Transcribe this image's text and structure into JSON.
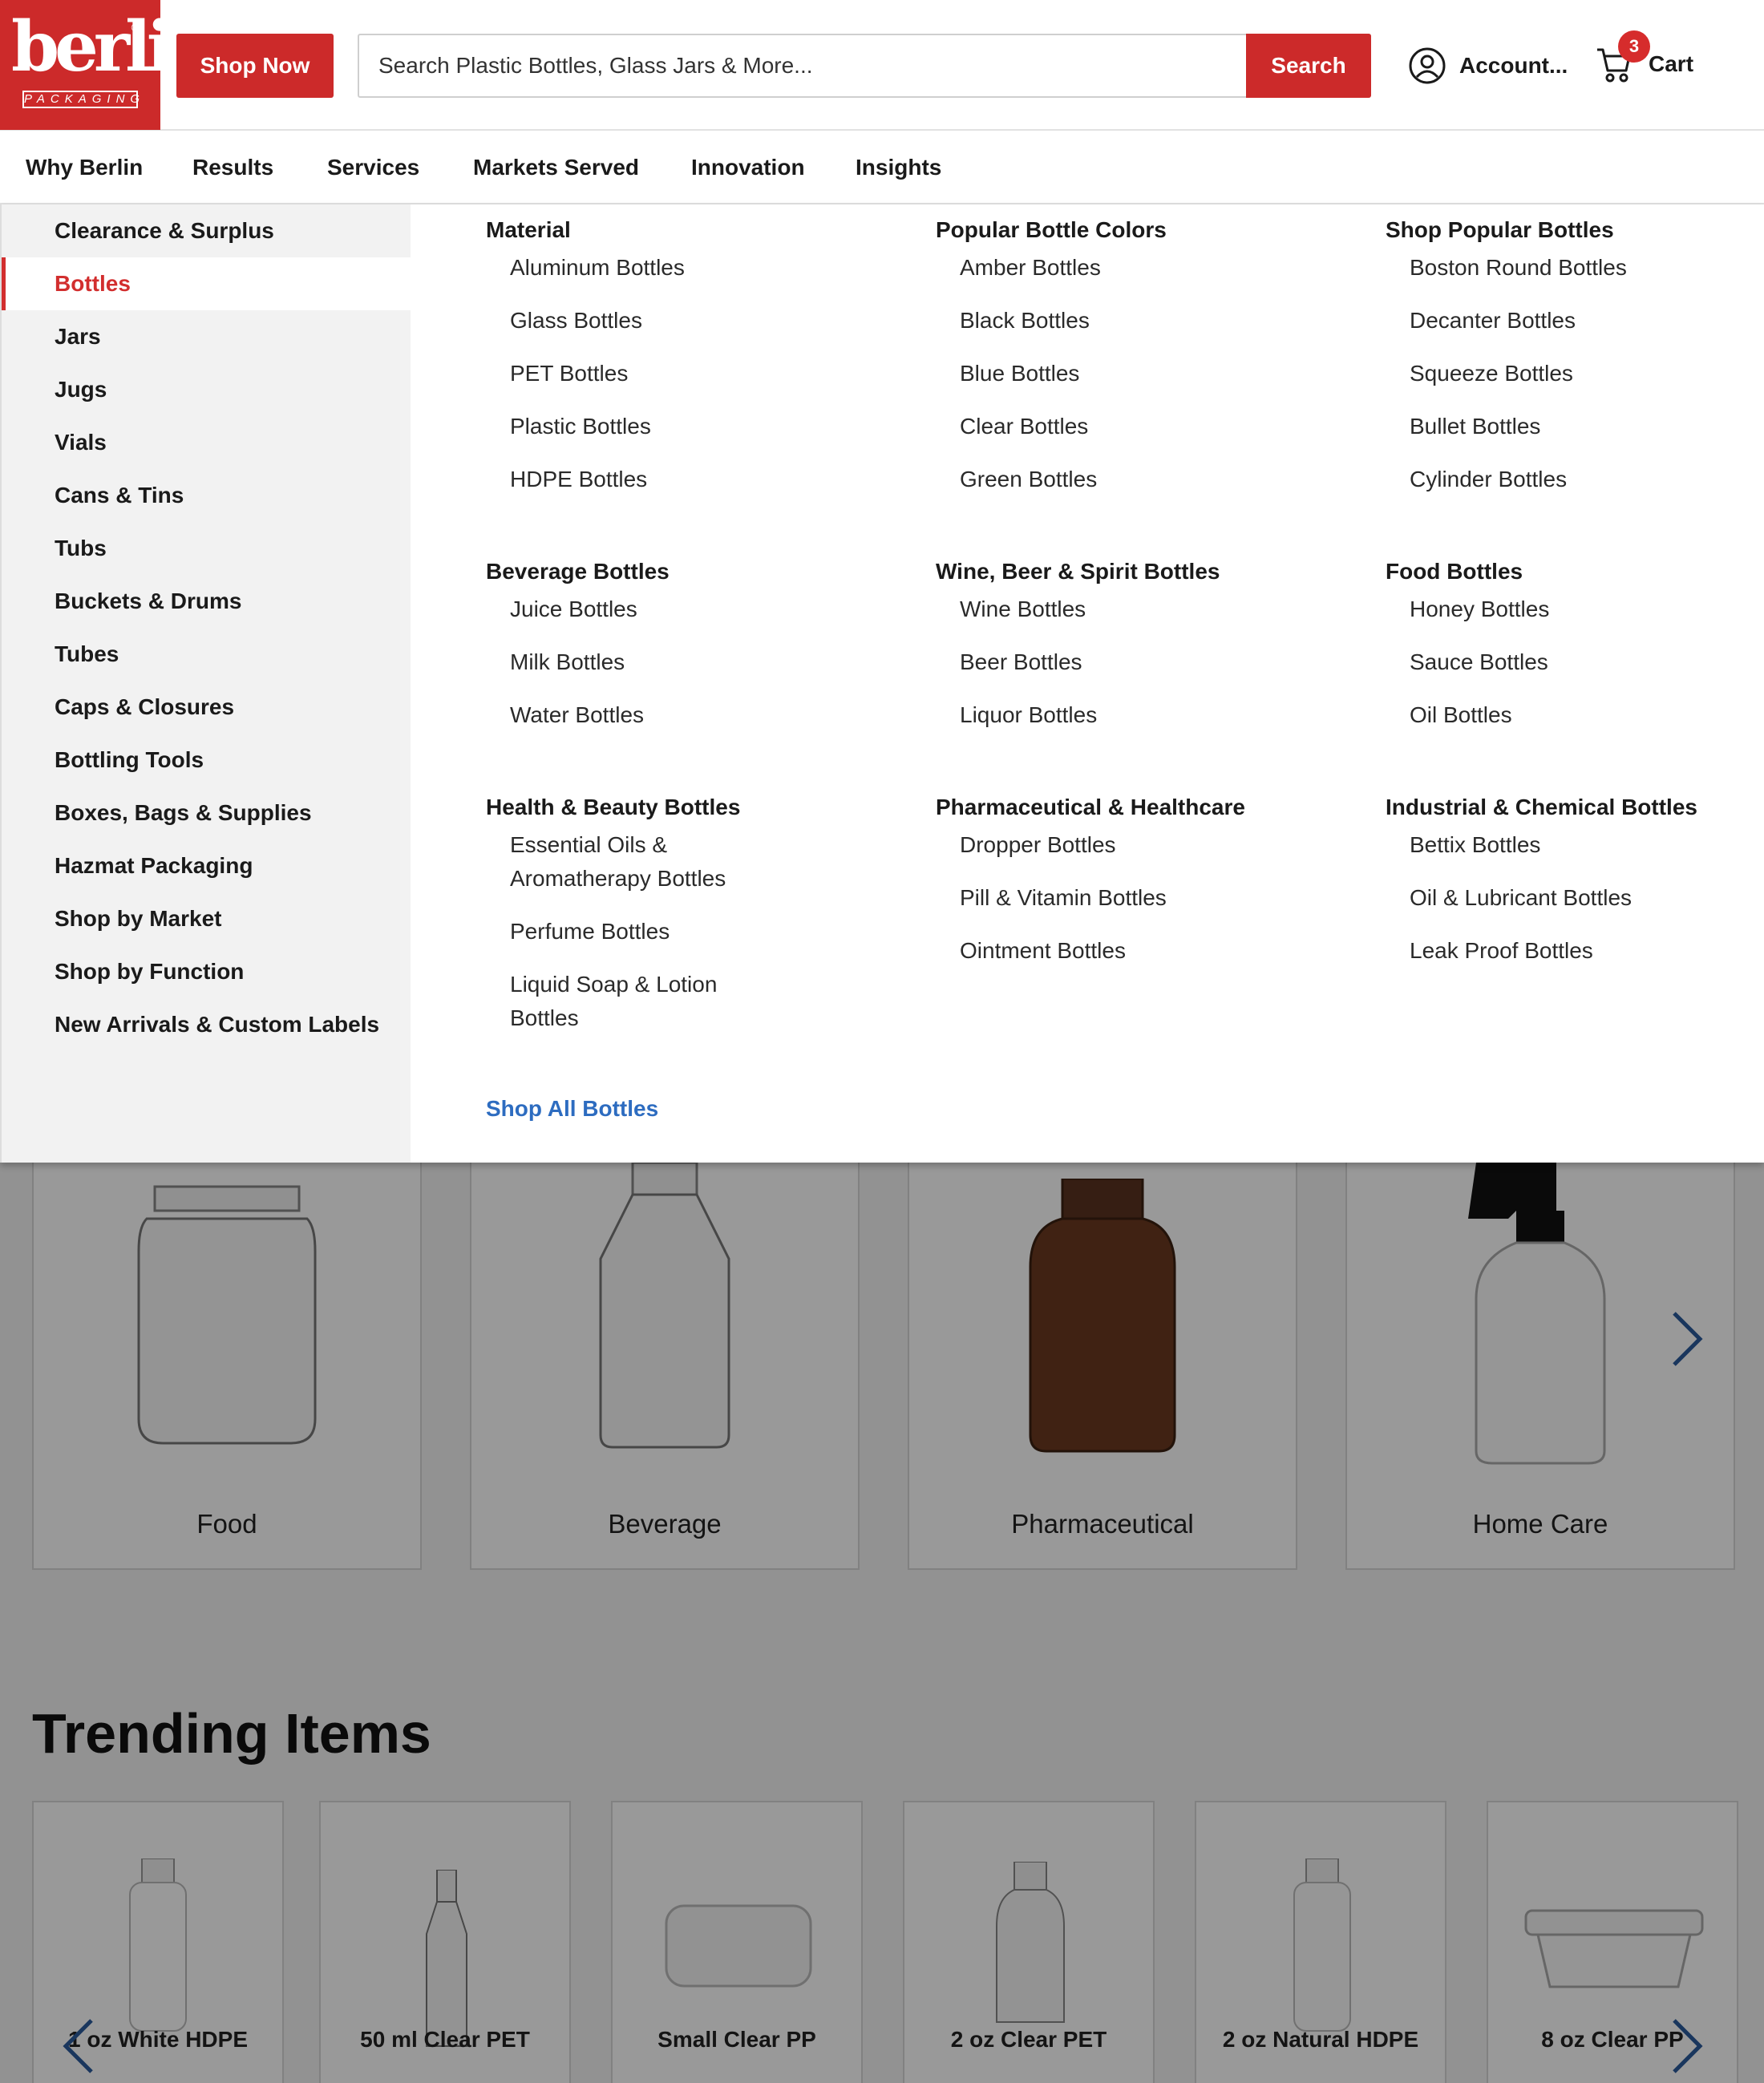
{
  "header": {
    "logo_text": "berlin",
    "logo_sub": "PACKAGING",
    "shop_now": "Shop Now",
    "search_placeholder": "Search Plastic Bottles, Glass Jars & More...",
    "search_button": "Search",
    "account": "Account...",
    "cart_label": "Cart",
    "cart_count": "3"
  },
  "nav": [
    "Why Berlin",
    "Results",
    "Services",
    "Markets Served",
    "Innovation",
    "Insights"
  ],
  "sidebar": [
    "Clearance & Surplus",
    "Bottles",
    "Jars",
    "Jugs",
    "Vials",
    "Cans & Tins",
    "Tubs",
    "Buckets & Drums",
    "Tubes",
    "Caps & Closures",
    "Bottling Tools",
    "Boxes, Bags & Supplies",
    "Hazmat Packaging",
    "Shop by Market",
    "Shop by Function",
    "New Arrivals & Custom Labels"
  ],
  "sidebar_active": "Bottles",
  "menu": {
    "col1": {
      "material": {
        "title": "Material",
        "links": [
          "Aluminum Bottles",
          "Glass Bottles",
          "PET Bottles",
          "Plastic Bottles",
          "HDPE Bottles"
        ]
      },
      "beverage": {
        "title": "Beverage Bottles",
        "links": [
          "Juice Bottles",
          "Milk Bottles",
          "Water Bottles"
        ]
      },
      "health": {
        "title": "Health & Beauty Bottles",
        "links": [
          "Essential Oils &",
          "Aromatherapy Bottles",
          "Perfume Bottles",
          "Liquid Soap & Lotion",
          "Bottles"
        ]
      }
    },
    "col2": {
      "colors": {
        "title": "Popular Bottle Colors",
        "links": [
          "Amber Bottles",
          "Black Bottles",
          "Blue Bottles",
          "Clear Bottles",
          "Green Bottles"
        ]
      },
      "wine": {
        "title": "Wine, Beer & Spirit Bottles",
        "links": [
          "Wine Bottles",
          "Beer Bottles",
          "Liquor Bottles"
        ]
      },
      "pharma": {
        "title": "Pharmaceutical & Healthcare",
        "links": [
          "Dropper Bottles",
          "Pill & Vitamin Bottles",
          "Ointment Bottles"
        ]
      }
    },
    "col3": {
      "popular": {
        "title": "Shop Popular Bottles",
        "links": [
          "Boston Round Bottles",
          "Decanter Bottles",
          "Squeeze Bottles",
          "Bullet Bottles",
          "Cylinder Bottles"
        ]
      },
      "food": {
        "title": "Food Bottles",
        "links": [
          "Honey Bottles",
          "Sauce Bottles",
          "Oil Bottles"
        ]
      },
      "industrial": {
        "title": "Industrial & Chemical Bottles",
        "links": [
          "Bettix Bottles",
          "Oil & Lubricant Bottles",
          "Leak Proof Bottles"
        ]
      }
    },
    "shop_all": "Shop All Bottles"
  },
  "categories": [
    "Food",
    "Beverage",
    "Pharmaceutical",
    "Home Care"
  ],
  "trending": {
    "title": "Trending Items",
    "items": [
      "1 oz White HDPE",
      "50 ml Clear PET",
      "Small Clear PP",
      "2 oz Clear PET",
      "2 oz Natural HDPE",
      "8 oz Clear PP"
    ]
  },
  "colors": {
    "brand_red": "#cc2a2a",
    "link_blue": "#2d6cc0",
    "arrow_blue": "#2a5a9c"
  }
}
